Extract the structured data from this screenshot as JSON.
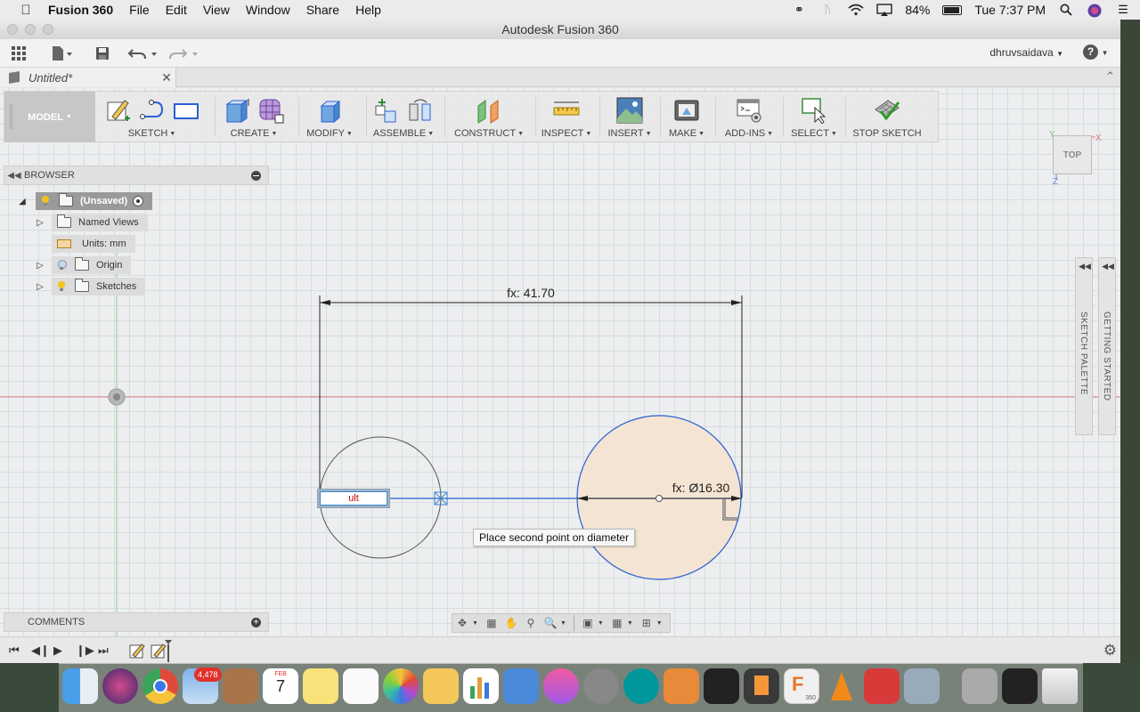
{
  "menubar": {
    "app_name": "Fusion 360",
    "items": [
      "File",
      "Edit",
      "View",
      "Window",
      "Share",
      "Help"
    ],
    "battery": "84%",
    "clock": "Tue 7:37 PM"
  },
  "window": {
    "title": "Autodesk Fusion 360",
    "user": "dhruvsaidava",
    "tab_title": "Untitled*"
  },
  "toolbar": {
    "workspace": "MODEL",
    "groups": [
      "SKETCH",
      "CREATE",
      "MODIFY",
      "ASSEMBLE",
      "CONSTRUCT",
      "INSPECT",
      "INSERT",
      "MAKE",
      "ADD-INS",
      "SELECT",
      "STOP SKETCH"
    ]
  },
  "browser": {
    "title": "BROWSER",
    "root": "(Unsaved)",
    "items": [
      "Named Views",
      "Units: mm",
      "Origin",
      "Sketches"
    ]
  },
  "comments": {
    "title": "COMMENTS"
  },
  "viewcube": {
    "label": "TOP",
    "axes": [
      "Y",
      "X",
      "Z"
    ]
  },
  "side_palettes": [
    "SKETCH PALETTE",
    "GETTING STARTED"
  ],
  "sketch": {
    "width_dimension": "fx: 41.70",
    "diameter_dimension": "fx: Ø16.30",
    "input_value": "ult",
    "tooltip": "Place second point on diameter"
  },
  "colors": {
    "sketch_blue": "#2a5fd4",
    "profile_fill": "#f4e4d3",
    "x_axis": "#d9534f",
    "y_axis": "#5cb85c"
  },
  "dock": {
    "mail_badge": "4,478",
    "calendar_month": "FEB",
    "calendar_day": "7",
    "fusion_label": "360"
  }
}
